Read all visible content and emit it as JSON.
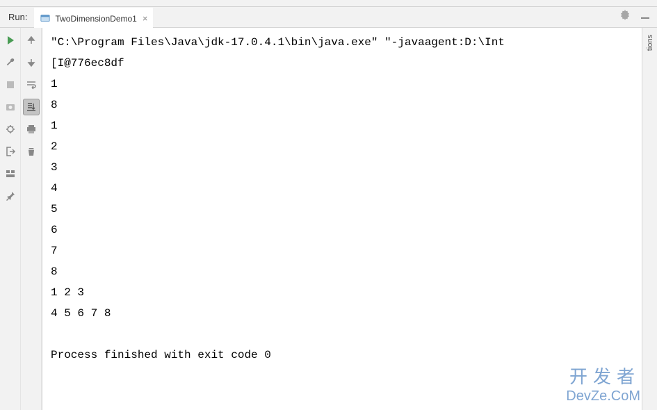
{
  "header": {
    "run_label": "Run:",
    "tab": {
      "label": "TwoDimensionDemo1"
    }
  },
  "right_panel": {
    "label": "tions"
  },
  "console": {
    "lines": [
      "\"C:\\Program Files\\Java\\jdk-17.0.4.1\\bin\\java.exe\" \"-javaagent:D:\\Int",
      "[I@776ec8df",
      "1",
      "8",
      "1",
      "2",
      "3",
      "4",
      "5",
      "6",
      "7",
      "8",
      "1 2 3",
      "4 5 6 7 8",
      "",
      "Process finished with exit code 0"
    ]
  },
  "watermark": {
    "cn": "开发者",
    "en": "DevZe.CoM"
  }
}
